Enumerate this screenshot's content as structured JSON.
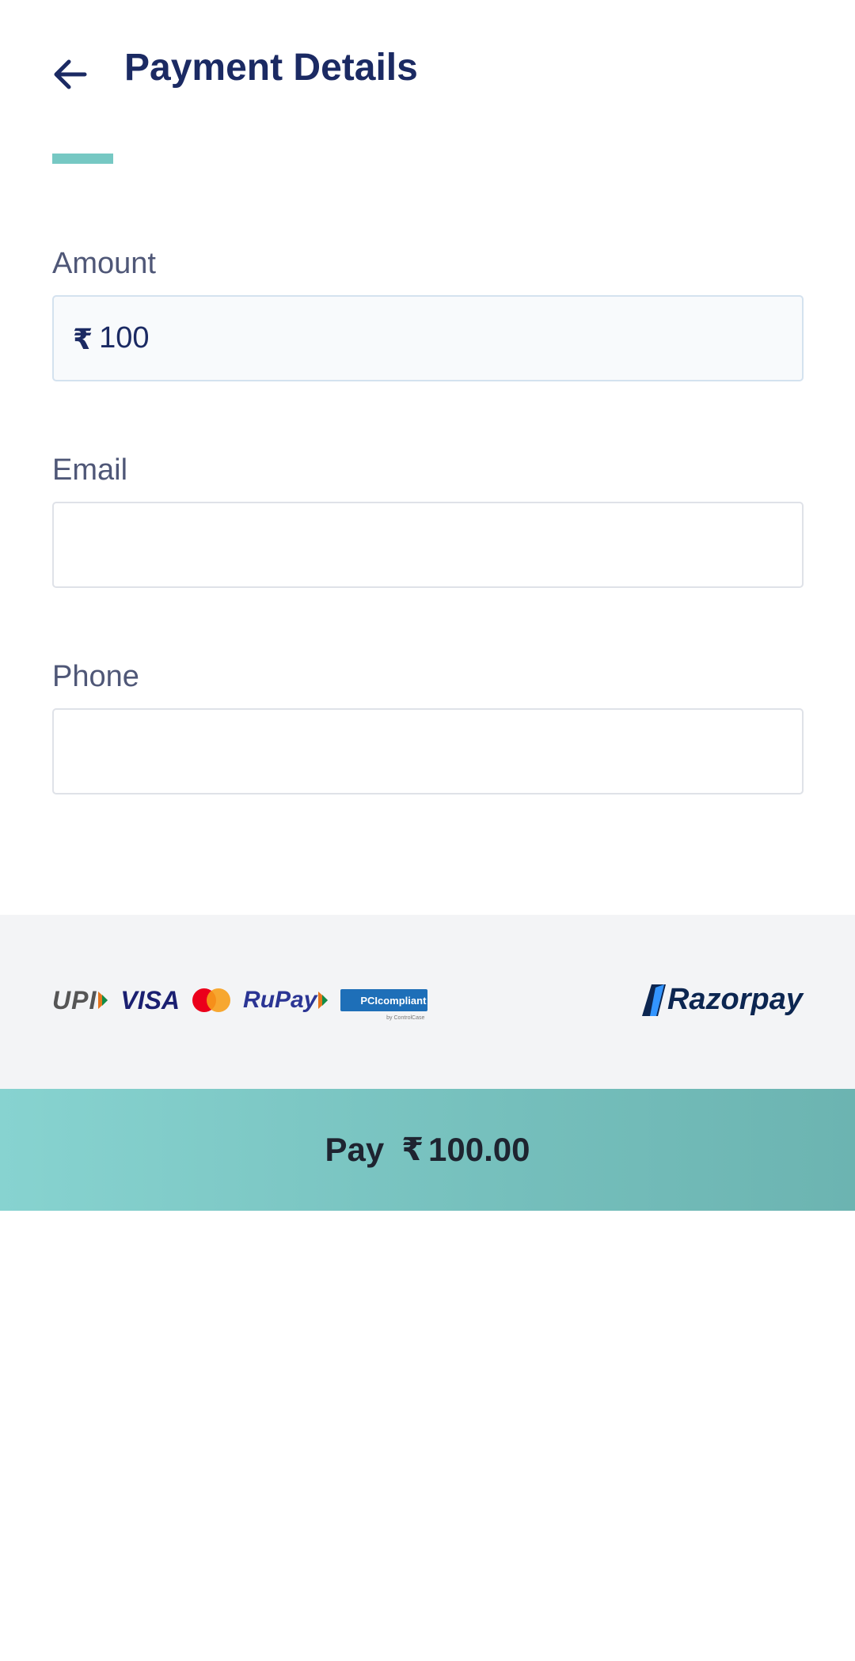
{
  "header": {
    "title": "Payment Details"
  },
  "form": {
    "amount": {
      "label": "Amount",
      "currency_symbol": "₹",
      "value": "100"
    },
    "email": {
      "label": "Email",
      "value": ""
    },
    "phone": {
      "label": "Phone",
      "value": ""
    }
  },
  "badges": {
    "upi": "UPI",
    "visa": "VISA",
    "rupay": "RuPay",
    "pci": "PCIcompliant",
    "pci_sub": "by ControlCase",
    "brand": "Razorpay"
  },
  "pay_button": {
    "label": "Pay",
    "currency_symbol": "₹",
    "amount": "100.00"
  },
  "colors": {
    "title": "#1b2a63",
    "accent": "#76c8c3",
    "button": "#7fc9c6"
  }
}
